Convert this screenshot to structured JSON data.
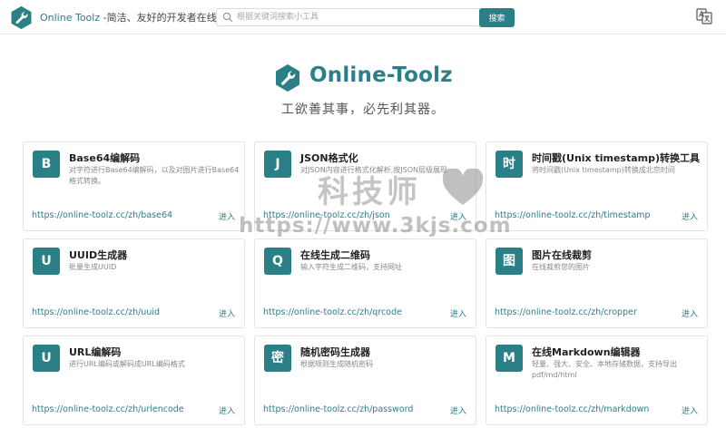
{
  "header": {
    "brand_name": "Online Toolz",
    "brand_tagline": " -简洁、友好的开发者在线工具",
    "search_placeholder": "根据关键词搜索小工具",
    "search_button": "搜索",
    "language_icon": "translate-icon"
  },
  "hero": {
    "title": "Online-Toolz",
    "slogan": "工欲善其事，必先利其器。"
  },
  "tools": [
    {
      "badge": "B",
      "title": "Base64编解码",
      "desc": "对字符进行Base64编解码，以及对图片进行Base64格式转换。",
      "url": "https://online-toolz.cc/zh/base64",
      "enter": "进入"
    },
    {
      "badge": "J",
      "title": "JSON格式化",
      "desc": "对JSON内容进行格式化解析,按JSON层级展现",
      "url": "https://online-toolz.cc/zh/json",
      "enter": "进入"
    },
    {
      "badge": "时",
      "title": "时间戳(Unix timestamp)转换工具",
      "desc": "将时间戳(Unix timestamp)转换成北京时间",
      "url": "https://online-toolz.cc/zh/timestamp",
      "enter": "进入"
    },
    {
      "badge": "U",
      "title": "UUID生成器",
      "desc": "批量生成UUID",
      "url": "https://online-toolz.cc/zh/uuid",
      "enter": "进入"
    },
    {
      "badge": "Q",
      "title": "在线生成二维码",
      "desc": "输入字符生成二维码，支持网址",
      "url": "https://online-toolz.cc/zh/qrcode",
      "enter": "进入"
    },
    {
      "badge": "图",
      "title": "图片在线裁剪",
      "desc": "在线裁剪您的图片",
      "url": "https://online-toolz.cc/zh/cropper",
      "enter": "进入"
    },
    {
      "badge": "U",
      "title": "URL编解码",
      "desc": "进行URL编码或解码成URL编码格式",
      "url": "https://online-toolz.cc/zh/urlencode",
      "enter": "进入"
    },
    {
      "badge": "密",
      "title": "随机密码生成器",
      "desc": "根据规则生成随机密码",
      "url": "https://online-toolz.cc/zh/password",
      "enter": "进入"
    },
    {
      "badge": "M",
      "title": "在线Markdown编辑器",
      "desc": "轻量、强大、安全、本地存储数据，支持导出pdf/md/html",
      "url": "https://online-toolz.cc/zh/markdown",
      "enter": "进入"
    }
  ],
  "watermark": {
    "text": "科技师",
    "url": "https://www.3kjs.com"
  },
  "colors": {
    "accent": "#2b7f86"
  }
}
